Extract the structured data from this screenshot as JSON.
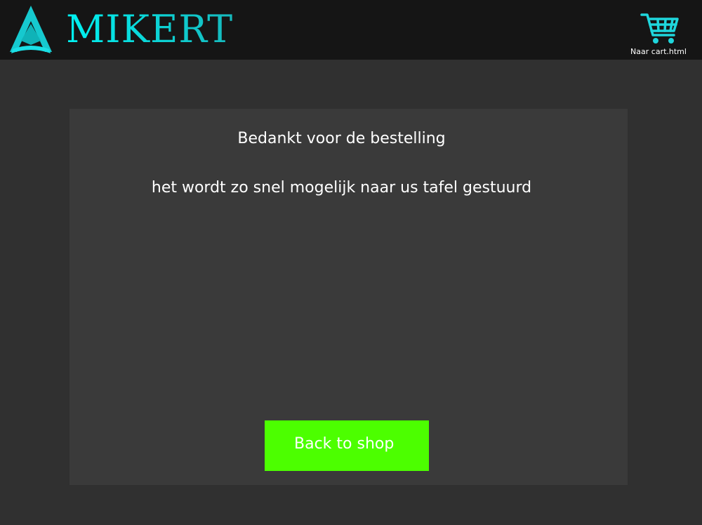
{
  "header": {
    "logo_text": "MIKERT",
    "cart_label": "Naar cart.html"
  },
  "main": {
    "thanks_text": "Bedankt voor de bestelling",
    "message_text": "het wordt zo snel mogelijk naar us tafel gestuurd",
    "back_button_label": "Back to shop"
  },
  "colors": {
    "background": "#303030",
    "header_bg": "#151515",
    "panel_bg": "#3a3a3a",
    "accent_cyan": "#17cfd6",
    "button_green": "#4cff00",
    "text": "#ffffff"
  },
  "icons": {
    "logo": "logo-triangle-icon",
    "cart": "shopping-cart-icon"
  }
}
